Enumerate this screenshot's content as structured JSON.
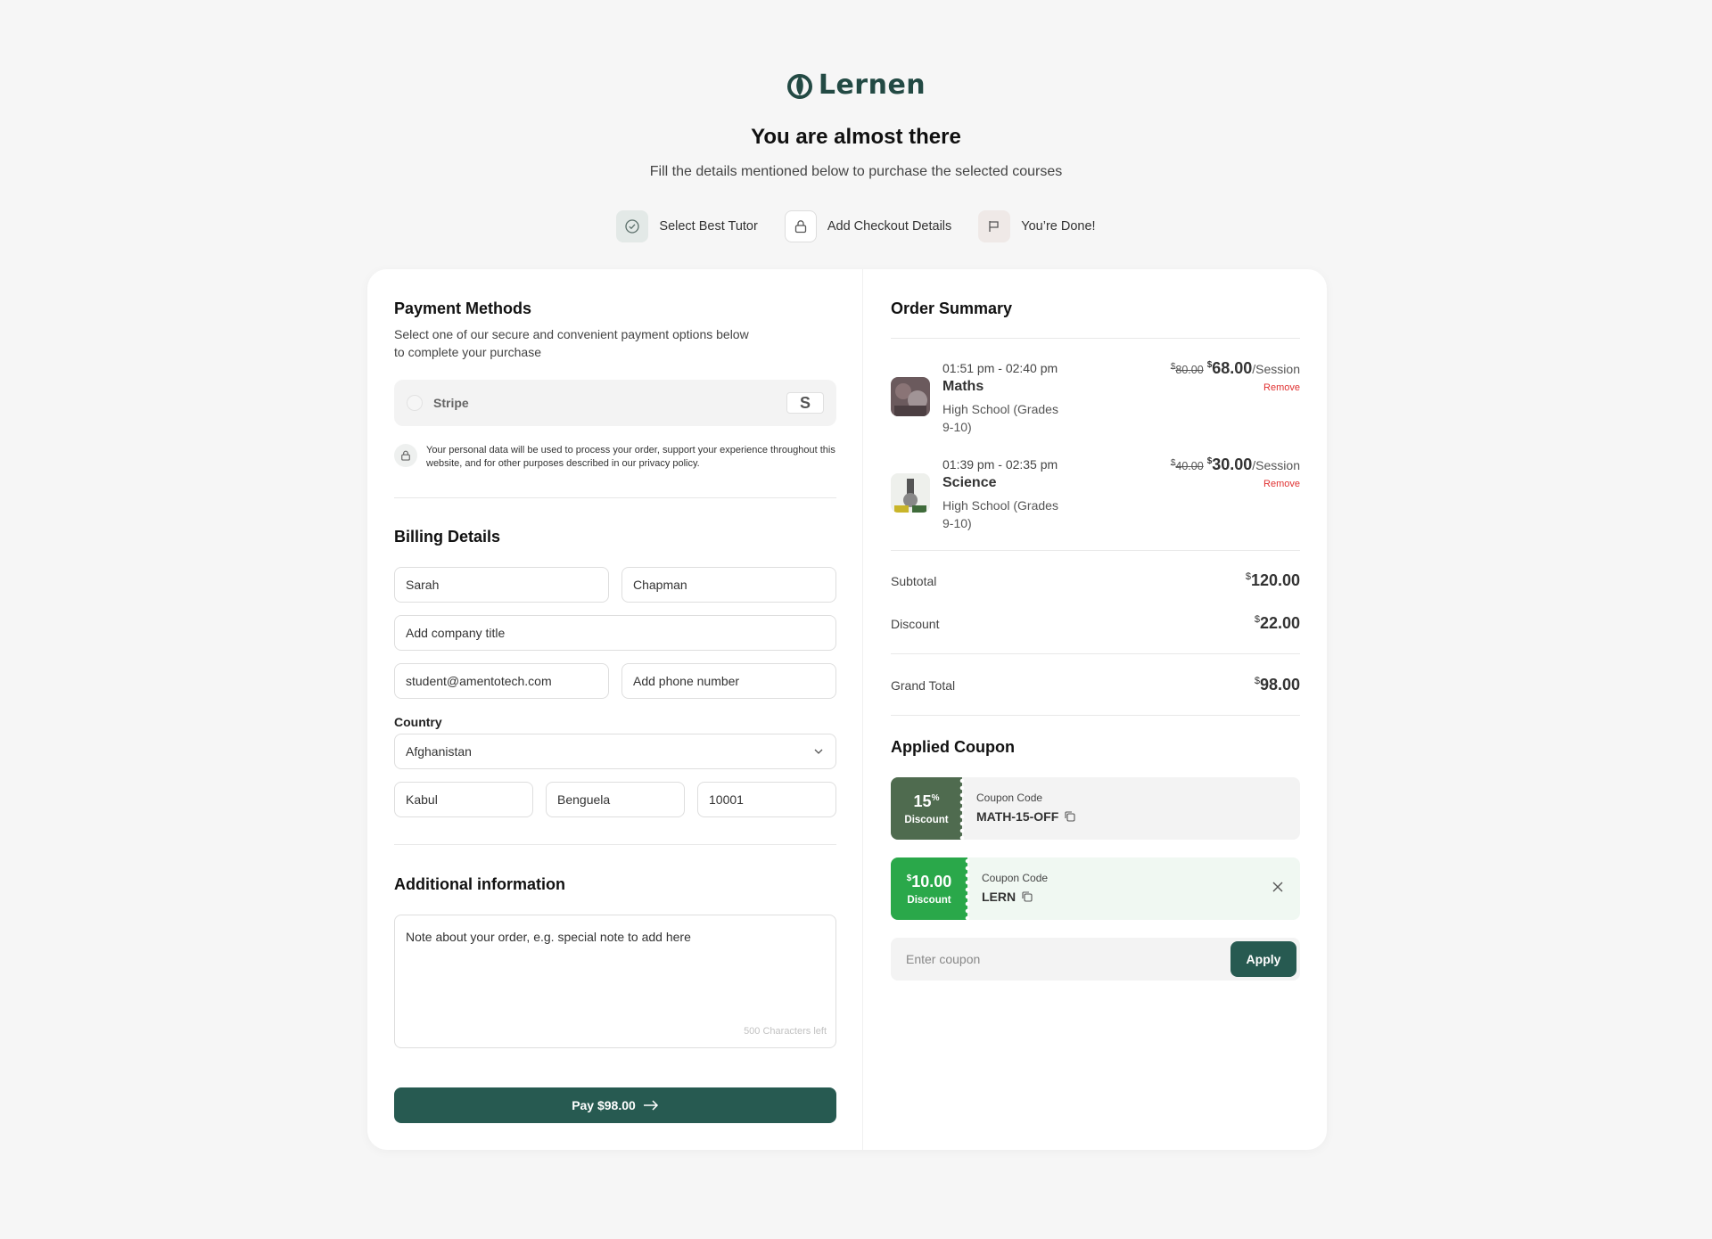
{
  "brand": {
    "name": "Lernen",
    "color": "#275a51"
  },
  "hero": {
    "title": "You are almost there",
    "subtitle": "Fill the details mentioned below to purchase the selected courses"
  },
  "steps": [
    {
      "label": "Select Best Tutor",
      "icon": "check-circle-icon",
      "state": "done"
    },
    {
      "label": "Add Checkout Details",
      "icon": "lock-icon",
      "state": "current"
    },
    {
      "label": "You’re Done!",
      "icon": "flag-icon",
      "state": "pending"
    }
  ],
  "payment": {
    "title": "Payment Methods",
    "description": "Select one of our secure and convenient payment options below to complete your purchase",
    "option_label": "Stripe",
    "option_badge": "S",
    "privacy_text": "Your personal data will be used to process your order, support your experience throughout this website, and for other purposes described in our privacy policy."
  },
  "billing": {
    "title": "Billing Details",
    "first_name": "Sarah",
    "last_name": "Chapman",
    "company_placeholder": "Add company title",
    "email": "student@amentotech.com",
    "phone_placeholder": "Add phone number",
    "country_label": "Country",
    "country": "Afghanistan",
    "city": "Kabul",
    "state": "Benguela",
    "zip": "10001"
  },
  "additional": {
    "title": "Additional information",
    "note_placeholder": "Note about your order, e.g. special note to add here",
    "chars_left": "500 Characters left"
  },
  "pay_button": "Pay $98.00",
  "order": {
    "title": "Order Summary",
    "items": [
      {
        "time": "01:51 pm - 02:40 pm",
        "subject": "Maths",
        "level": "High School (Grades 9-10)",
        "old_price": "80.00",
        "price": "68.00",
        "unit": "/Session",
        "remove": "Remove"
      },
      {
        "time": "01:39 pm - 02:35 pm",
        "subject": "Science",
        "level": "High School (Grades 9-10)",
        "old_price": "40.00",
        "price": "30.00",
        "unit": "/Session",
        "remove": "Remove"
      }
    ],
    "currency": "$",
    "subtotal_label": "Subtotal",
    "subtotal": "120.00",
    "discount_label": "Discount",
    "discount": "22.00",
    "grand_total_label": "Grand Total",
    "grand_total": "98.00"
  },
  "coupons": {
    "title": "Applied Coupon",
    "items": [
      {
        "amount": "15",
        "amount_sup": "%",
        "caption": "Discount",
        "code_label": "Coupon Code",
        "code": "MATH-15-OFF",
        "color": "#4f6b4f",
        "bg": "#f3f3f3"
      },
      {
        "amount_pre": "$",
        "amount": "10.00",
        "caption": "Discount",
        "code_label": "Coupon Code",
        "code": "LERN",
        "color": "#2aa84a",
        "bg": "#f0f8f2"
      }
    ],
    "input_placeholder": "Enter coupon",
    "apply_label": "Apply"
  }
}
